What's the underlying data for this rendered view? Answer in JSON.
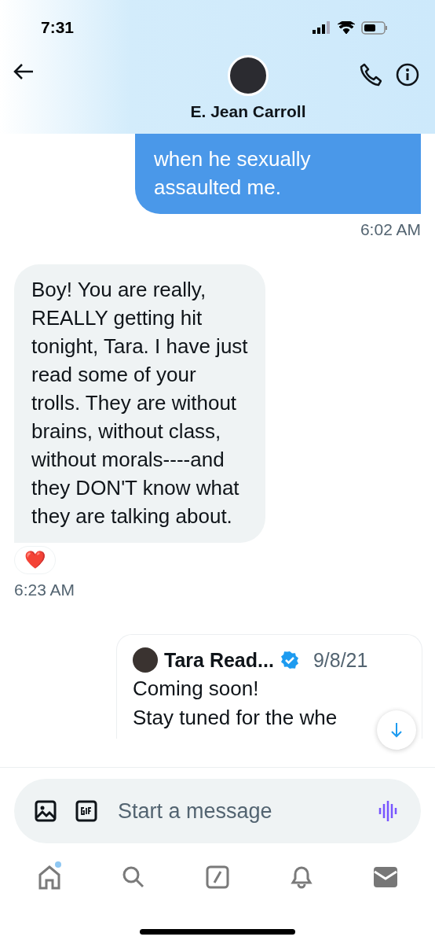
{
  "status_bar": {
    "time": "7:31"
  },
  "header": {
    "name": "E. Jean Carroll"
  },
  "messages": [
    {
      "kind": "sent",
      "text": "when he sexually\nassaulted me.",
      "time": "6:02 AM"
    },
    {
      "kind": "received",
      "text": "Boy! You are really,\nREALLY getting hit\ntonight, Tara. I have just\nread some of your\ntrolls.  They are without\nbrains, without class,\nwithout morals----and\nthey DON'T know what\nthey are talking about.",
      "reaction": "❤️",
      "time": "6:23 AM"
    },
    {
      "kind": "quote",
      "author": "Tara Read...",
      "verified": true,
      "date": "9/8/21",
      "text": "Coming soon!\nStay tuned for the whe"
    }
  ],
  "composer": {
    "placeholder": "Start a message"
  },
  "nav": [
    {
      "kind": "home",
      "selected": false,
      "badge": true
    },
    {
      "kind": "search",
      "selected": false,
      "badge": false
    },
    {
      "kind": "compose",
      "selected": false,
      "badge": false
    },
    {
      "kind": "bell",
      "selected": false,
      "badge": false
    },
    {
      "kind": "mail",
      "selected": true,
      "badge": false
    }
  ]
}
